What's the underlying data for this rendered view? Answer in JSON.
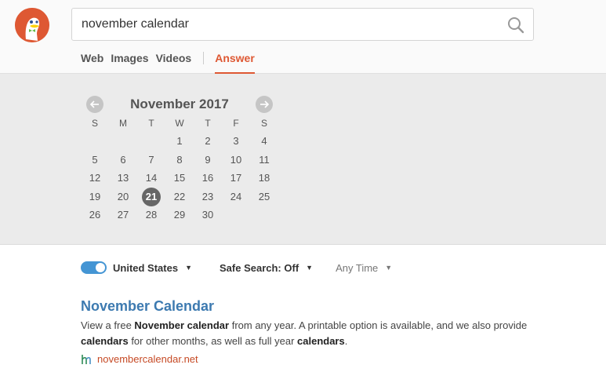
{
  "search": {
    "value": "november calendar",
    "placeholder": ""
  },
  "tabs": [
    {
      "label": "Web"
    },
    {
      "label": "Images"
    },
    {
      "label": "Videos"
    },
    {
      "label": "Answer"
    }
  ],
  "calendar": {
    "title": "November 2017",
    "weekdays": [
      "S",
      "M",
      "T",
      "W",
      "T",
      "F",
      "S"
    ],
    "weeks": [
      [
        "",
        "",
        "",
        "1",
        "2",
        "3",
        "4"
      ],
      [
        "5",
        "6",
        "7",
        "8",
        "9",
        "10",
        "11"
      ],
      [
        "12",
        "13",
        "14",
        "15",
        "16",
        "17",
        "18"
      ],
      [
        "19",
        "20",
        "21",
        "22",
        "23",
        "24",
        "25"
      ],
      [
        "26",
        "27",
        "28",
        "29",
        "30",
        "",
        ""
      ]
    ],
    "today": "21"
  },
  "filters": {
    "region": "United States",
    "safe_search": "Safe Search: Off",
    "time": "Any Time"
  },
  "result": {
    "title": "November Calendar",
    "snippet_parts": [
      {
        "text": "View a free ",
        "bold": false
      },
      {
        "text": "November calendar",
        "bold": true
      },
      {
        "text": " from any year. A printable option is available, and we also provide ",
        "bold": false
      },
      {
        "text": "calendars",
        "bold": true
      },
      {
        "text": " for other months, as well as full year ",
        "bold": false
      },
      {
        "text": "calendars",
        "bold": true
      },
      {
        "text": ".",
        "bold": false
      }
    ],
    "url": "novembercalendar.net"
  },
  "colors": {
    "accent": "#de5833",
    "link": "#3d7ab0",
    "toggle": "#4495d4",
    "url": "#c64a25"
  }
}
